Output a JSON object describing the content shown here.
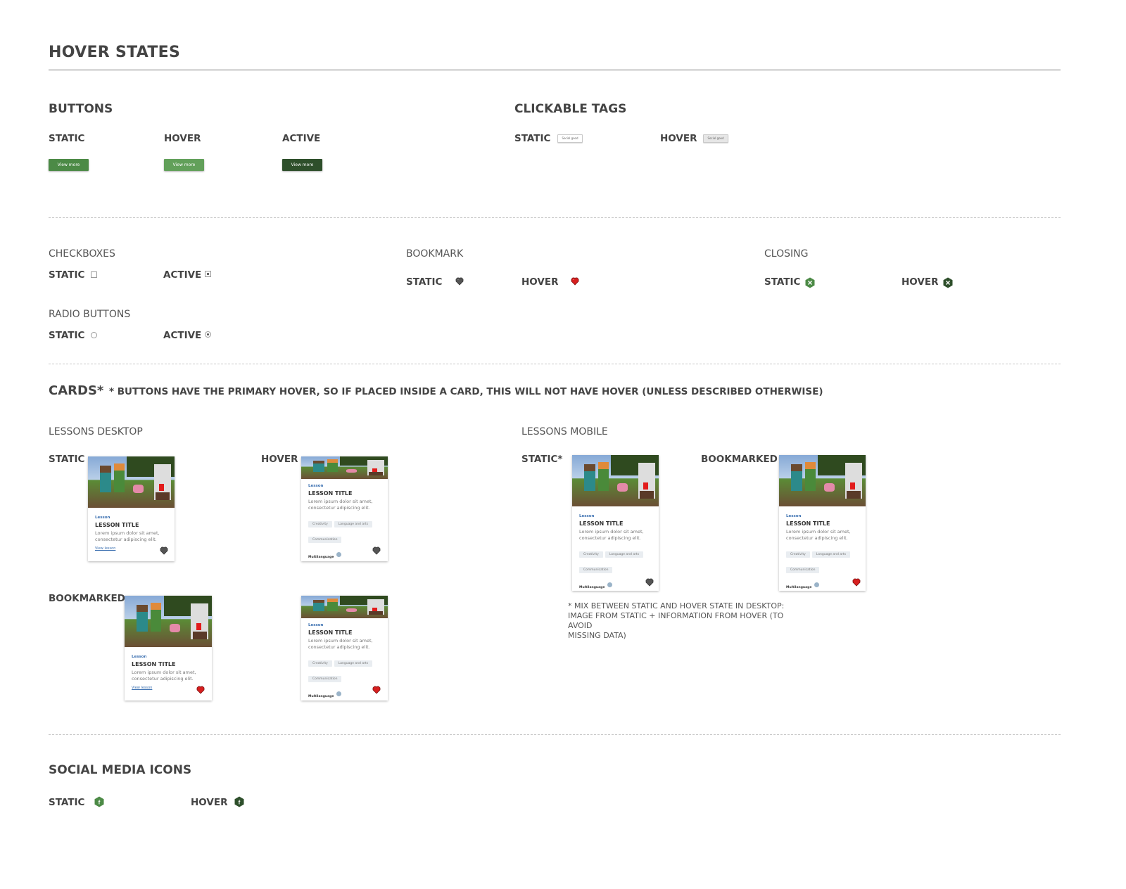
{
  "page_title": "HOVER STATES",
  "buttons": {
    "heading": "BUTTONS",
    "static_label": "STATIC",
    "hover_label": "HOVER",
    "active_label": "ACTIVE",
    "button_text": "View more",
    "colors": {
      "static": "#4c8a46",
      "hover": "#62a05a",
      "active": "#2e4f2b"
    }
  },
  "clickable_tags": {
    "heading": "CLICKABLE TAGS",
    "static_label": "STATIC",
    "hover_label": "HOVER",
    "tag_text": "Social good",
    "colors": {
      "static_bg": "#ffffff",
      "hover_bg": "#e6e6e6"
    }
  },
  "checkboxes": {
    "heading": "CHECKBOXES",
    "static_label": "STATIC",
    "active_label": "ACTIVE"
  },
  "radio_buttons": {
    "heading": "RADIO BUTTONS",
    "static_label": "STATIC",
    "active_label": "ACTIVE"
  },
  "bookmark": {
    "heading": "BOOKMARK",
    "static_label": "STATIC",
    "hover_label": "HOVER",
    "icons": {
      "static": "heart-outline-icon",
      "hover": "heart-filled-icon"
    },
    "colors": {
      "static": "#555555",
      "hover": "#d71f1f"
    }
  },
  "closing": {
    "heading": "CLOSING",
    "static_label": "STATIC",
    "hover_label": "HOVER",
    "icons": {
      "static": "close-hex-icon",
      "hover": "close-hex-icon"
    },
    "colors": {
      "static": "#4c8a46",
      "hover": "#2e4f2b"
    }
  },
  "cards": {
    "heading": "CARDS*",
    "note": "* BUTTONS HAVE THE PRIMARY HOVER, SO IF PLACED INSIDE A CARD, THIS WILL NOT HAVE HOVER (UNLESS DESCRIBED OTHERWISE)",
    "desktop_heading": "LESSONS DESKTOP",
    "mobile_heading": "LESSONS MOBILE",
    "labels": {
      "static": "STATIC",
      "hover": "HOVER",
      "bookmarked": "BOOKMARKED",
      "static_mobile": "STATIC*",
      "bookmarked_mobile": "BOOKMARKED"
    },
    "card": {
      "type": "Lesson",
      "title": "LESSON TITLE",
      "desc_line1": "Lorem ipsum dolor sit amet,",
      "desc_line2": "consectetur adipiscing elit.",
      "chips": [
        "Creativity",
        "Language and arts",
        "Communication"
      ],
      "multilanguage": "Multilanguage",
      "link": "View lesson"
    },
    "mobile_note_line1": "* MIX BETWEEN STATIC AND HOVER STATE IN DESKTOP:",
    "mobile_note_line2": "IMAGE FROM STATIC + INFORMATION FROM HOVER (TO AVOID",
    "mobile_note_line3": "MISSING DATA)"
  },
  "social": {
    "heading": "SOCIAL MEDIA ICONS",
    "static_label": "STATIC",
    "hover_label": "HOVER",
    "icons": {
      "static": "facebook-hex-icon",
      "hover": "facebook-hex-icon"
    },
    "colors": {
      "static": "#4c8a46",
      "hover": "#2e4f2b"
    }
  }
}
